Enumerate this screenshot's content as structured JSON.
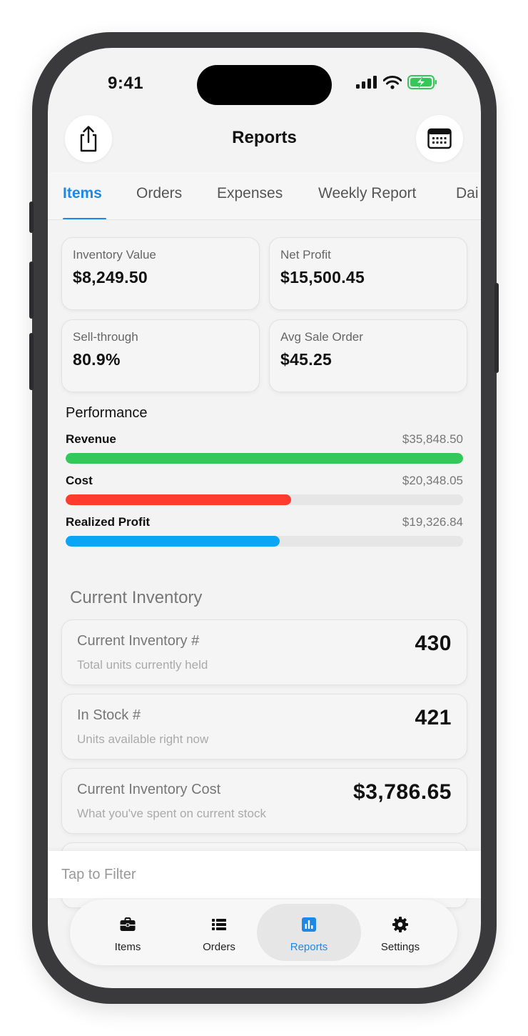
{
  "status_bar": {
    "time": "9:41"
  },
  "header": {
    "title": "Reports",
    "left_icon": "share-icon",
    "right_icon": "calendar-icon"
  },
  "tabs": [
    {
      "label": "Items",
      "active": true
    },
    {
      "label": "Orders",
      "active": false
    },
    {
      "label": "Expenses",
      "active": false
    },
    {
      "label": "Weekly Report",
      "active": false
    },
    {
      "label": "Dai",
      "active": false
    }
  ],
  "stats": [
    {
      "label": "Inventory Value",
      "value": "$8,249.50"
    },
    {
      "label": "Net Profit",
      "value": "$15,500.45"
    },
    {
      "label": "Sell-through",
      "value": "80.9%"
    },
    {
      "label": "Avg Sale Order",
      "value": "$45.25"
    }
  ],
  "performance": {
    "title": "Performance",
    "rows": [
      {
        "label": "Revenue",
        "amount": "$35,848.50",
        "fraction": 1.0,
        "color": "#34c759"
      },
      {
        "label": "Cost",
        "amount": "$20,348.05",
        "fraction": 0.567,
        "color": "#ff3b30"
      },
      {
        "label": "Realized Profit",
        "amount": "$19,326.84",
        "fraction": 0.539,
        "color": "#0aa5f5"
      }
    ]
  },
  "inventory": {
    "title": "Current Inventory",
    "cards": [
      {
        "title": "Current Inventory #",
        "subtitle": "Total units currently held",
        "value": "430"
      },
      {
        "title": "In Stock #",
        "subtitle": "Units available right now",
        "value": "421"
      },
      {
        "title": "Current Inventory Cost",
        "subtitle": "What you've spent on current stock",
        "value": "$3,786.65"
      }
    ]
  },
  "filter": {
    "label": "Tap to Filter"
  },
  "tabbar": [
    {
      "label": "Items",
      "icon": "briefcase-icon",
      "active": false
    },
    {
      "label": "Orders",
      "icon": "list-icon",
      "active": false
    },
    {
      "label": "Reports",
      "icon": "chart-icon",
      "active": true
    },
    {
      "label": "Settings",
      "icon": "gear-icon",
      "active": false
    }
  ],
  "colors": {
    "accent": "#1e88e5",
    "revenue": "#34c759",
    "cost": "#ff3b30",
    "profit": "#0aa5f5",
    "battery": "#34c759"
  }
}
